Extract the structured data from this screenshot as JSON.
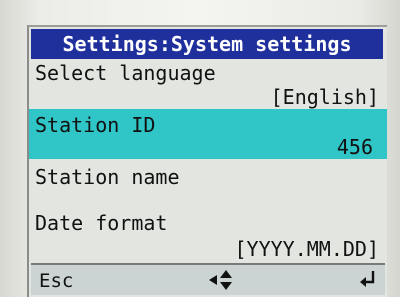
{
  "title": "Settings:System settings",
  "rows": [
    {
      "label": "Select language",
      "value": "[English]"
    },
    {
      "label": "Station ID",
      "value": "456"
    },
    {
      "label": "Station name",
      "value": ""
    },
    {
      "label": "Date format",
      "value": "[YYYY.MM.DD]"
    }
  ],
  "selected_row": "Station ID",
  "softkeys": {
    "left": "Esc",
    "center_icons": [
      "left-arrow-icon",
      "up-down-arrow-icon"
    ],
    "right_icon": "enter-icon"
  },
  "colors": {
    "title_bar": "#1f2f9c",
    "highlight": "#30c5c7",
    "screen_bg": "#e3e6e0"
  }
}
